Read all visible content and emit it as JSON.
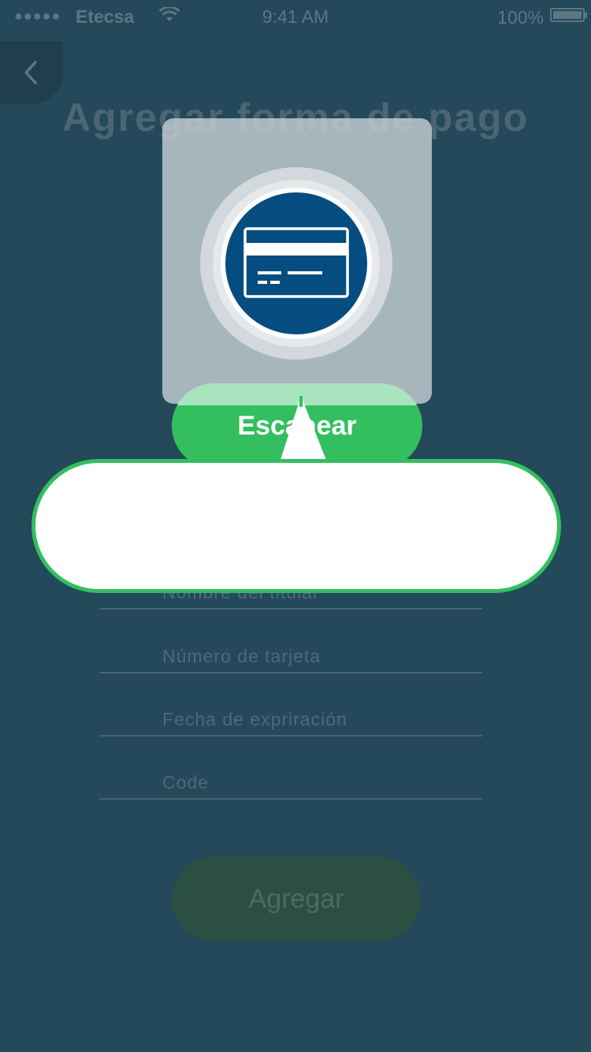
{
  "status_bar": {
    "signal_dots": "●●●●●",
    "carrier": "Etecsa",
    "time": "9:41 AM",
    "battery": "100%",
    "battery_level": 1.0
  },
  "header": {
    "title": "Agregar forma de pago",
    "back_icon": "chevron-left-icon"
  },
  "scan": {
    "icon": "credit-card-icon",
    "button_label": "Escanear"
  },
  "tooltip": {
    "text": ""
  },
  "form": {
    "fields": [
      {
        "placeholder": "Nombre del titular"
      },
      {
        "placeholder": "Número de tarjeta"
      },
      {
        "placeholder": "Fecha de exprir​ación"
      },
      {
        "placeholder": "Code"
      }
    ],
    "submit_label": "Agregar"
  },
  "colors": {
    "background": "#23495a",
    "accent_green": "#33bf5f",
    "card_blue": "#054d80"
  }
}
